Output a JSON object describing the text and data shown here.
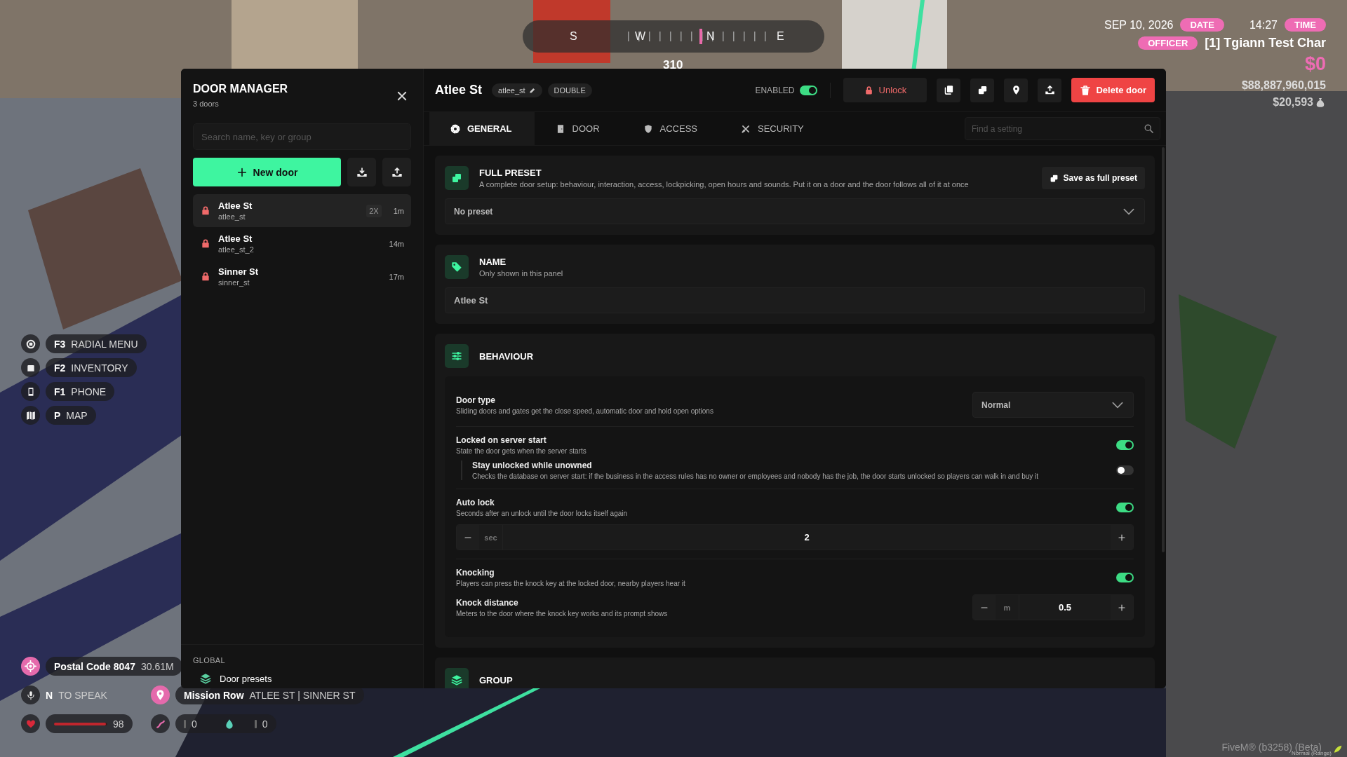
{
  "compass": {
    "points": [
      "S",
      "W",
      "N",
      "E"
    ],
    "heading": "310"
  },
  "clock": {
    "date": "SEP 10, 2026",
    "date_tag": "DATE",
    "time": "14:27",
    "time_tag": "TIME"
  },
  "player": {
    "job": "OFFICER",
    "name": "[1] Tgiann Test Char",
    "cash": "$0",
    "bank": "$88,887,960,015",
    "black_money": "$20,593"
  },
  "hotkeys": [
    {
      "key": "F3",
      "label": "RADIAL MENU"
    },
    {
      "key": "F2",
      "label": "INVENTORY"
    },
    {
      "key": "F1",
      "label": "PHONE"
    },
    {
      "key": "P",
      "label": "MAP"
    }
  ],
  "location": {
    "postal": "Postal Code 8047",
    "distance": "30.61M",
    "area": "Mission Row",
    "streets": "ATLEE ST | SINNER ST"
  },
  "voice": {
    "key": "N",
    "label": "TO SPEAK"
  },
  "status": {
    "health": {
      "level": 0.98,
      "value": "98"
    },
    "stamina": {
      "value": "0"
    },
    "thirst": {
      "value": "0"
    }
  },
  "client": {
    "build": "FiveM® (b3258) (Beta)",
    "voice_mode": "Normal (Range)"
  },
  "sidebar": {
    "title": "DOOR MANAGER",
    "count": "3 doors",
    "search": {
      "placeholder": "Search name, key or group"
    },
    "new_button": "New door",
    "doors": [
      {
        "name": "Atlee St",
        "key": "atlee_st",
        "badge": "2X",
        "age": "1m",
        "locked": true,
        "selected": true
      },
      {
        "name": "Atlee St",
        "key": "atlee_st_2",
        "age": "14m",
        "locked": true,
        "selected": false
      },
      {
        "name": "Sinner St",
        "key": "sinner_st",
        "age": "17m",
        "locked": true,
        "selected": false
      }
    ],
    "section": "GLOBAL",
    "links": [
      "Door presets"
    ]
  },
  "door": {
    "title": "Atlee St",
    "key": "atlee_st",
    "type_tag": "DOUBLE",
    "enabled": {
      "label": "ENABLED",
      "on": true
    },
    "unlock": "Unlock",
    "delete": "Delete door"
  },
  "tabs": [
    {
      "label": "GENERAL",
      "selected": true
    },
    {
      "label": "DOOR",
      "selected": false
    },
    {
      "label": "ACCESS",
      "selected": false
    },
    {
      "label": "SECURITY",
      "selected": false
    }
  ],
  "setting_search": {
    "placeholder": "Find a setting"
  },
  "sections": [
    {
      "kind": "preset",
      "title": "FULL PRESET",
      "subtitle": "A complete door setup: behaviour, interaction, access, lockpicking, open hours and sounds. Put it on a door and the door follows all of it at once",
      "action": "Save as full preset",
      "value": "No preset"
    },
    {
      "kind": "text",
      "title": "NAME",
      "subtitle": "Only shown in this panel",
      "value": "Atlee St"
    },
    {
      "kind": "settings",
      "title": "BEHAVIOUR",
      "groups": [
        {
          "rows": [
            {
              "kind": "select",
              "label": "Door type",
              "description": "Sliding doors and gates get the close speed, automatic door and hold open options",
              "value": "Normal"
            }
          ]
        },
        {
          "rows": [
            {
              "kind": "toggle",
              "label": "Locked on server start",
              "description": "State the door gets when the server starts",
              "on": true,
              "children": [
                {
                  "kind": "toggle",
                  "label": "Stay unlocked while unowned",
                  "description": "Checks the database on server start: if the business in the access rules has no owner or employees and nobody has the job, the door starts unlocked so players can walk in and buy it",
                  "on": false
                }
              ]
            }
          ]
        },
        {
          "rows": [
            {
              "kind": "toggle",
              "label": "Auto lock",
              "description": "Seconds after an unlock until the door locks itself again",
              "on": true
            },
            {
              "kind": "wide_stepper",
              "unit": "sec",
              "value": "2"
            }
          ]
        },
        {
          "rows": [
            {
              "kind": "toggle",
              "label": "Knocking",
              "description": "Players can press the knock key at the locked door, nearby players hear it",
              "on": true
            },
            {
              "kind": "stepper",
              "label": "Knock distance",
              "description": "Meters to the door where the knock key works and its prompt shows",
              "unit": "m",
              "value": "0.5"
            }
          ]
        }
      ]
    },
    {
      "kind": "settings",
      "title": "GROUP"
    }
  ]
}
